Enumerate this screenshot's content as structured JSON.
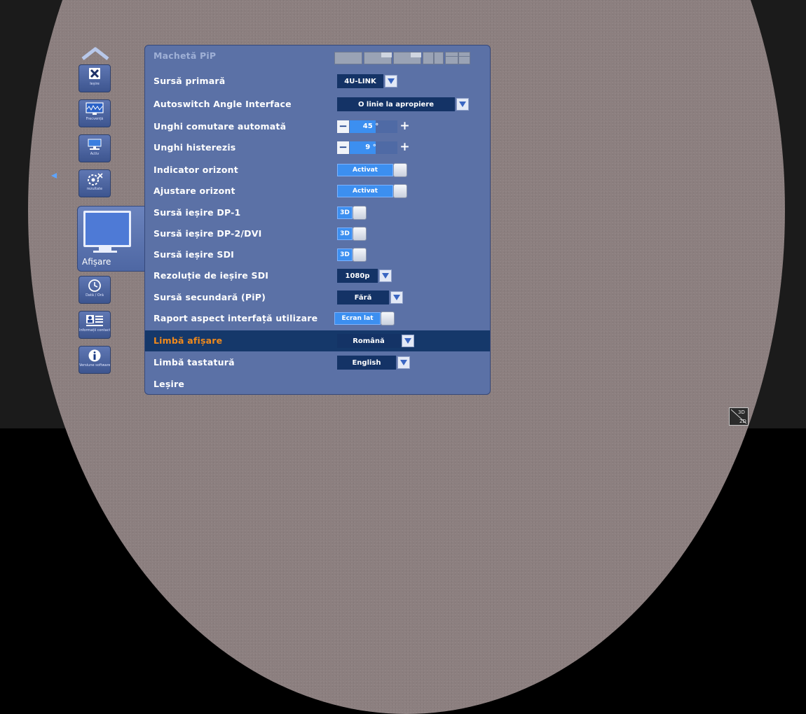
{
  "menu": {
    "rows": [
      {
        "key": "pip-layout",
        "label": "Machetă PiP",
        "control": "pip-layouts",
        "state": "disabled"
      },
      {
        "key": "primary-source",
        "label": "Sursă primară",
        "control": "dropdown",
        "value": "4U-LINK"
      },
      {
        "key": "autoswitch",
        "label": "Autoswitch Angle Interface",
        "control": "dropdown",
        "value": "O linie la apropiere"
      },
      {
        "key": "auto-switch-angle",
        "label": "Unghi comutare automată",
        "control": "stepper",
        "value": "45 °",
        "fill": 0.55
      },
      {
        "key": "hysteresis-angle",
        "label": "Unghi histerezis",
        "control": "stepper",
        "value": "9 °",
        "fill": 0.55
      },
      {
        "key": "horizon-indicator",
        "label": "Indicator orizont",
        "control": "toggle",
        "value": "Activat"
      },
      {
        "key": "horizon-adjust",
        "label": "Ajustare orizont",
        "control": "toggle",
        "value": "Activat"
      },
      {
        "key": "dp1-output",
        "label": "Sursă ieșire DP-1",
        "control": "toggle",
        "value": "3D"
      },
      {
        "key": "dp2-output",
        "label": "Sursă ieșire DP-2/DVI",
        "control": "toggle",
        "value": "3D"
      },
      {
        "key": "sdi-output",
        "label": "Sursă ieșire SDI",
        "control": "toggle",
        "value": "3D"
      },
      {
        "key": "sdi-resolution",
        "label": "Rezoluție de ieșire SDI",
        "control": "dropdown",
        "value": "1080p"
      },
      {
        "key": "secondary-source",
        "label": "Sursă secundară (PiP)",
        "control": "dropdown",
        "value": "Fără"
      },
      {
        "key": "ui-aspect",
        "label": "Raport aspect interfață utilizare",
        "control": "toggle",
        "value": "Ecran lat"
      },
      {
        "key": "display-language",
        "label": "Limbă afișare",
        "control": "dropdown",
        "value": "Română",
        "state": "selected"
      },
      {
        "key": "keyboard-language",
        "label": "Limbă tastatură",
        "control": "dropdown",
        "value": "English"
      },
      {
        "key": "exit",
        "label": "Leșire",
        "control": "none"
      }
    ]
  },
  "nav": {
    "items": [
      {
        "key": "exit",
        "label": "Ieșire",
        "icon": "close-x-icon"
      },
      {
        "key": "frequency",
        "label": "Frecvență",
        "icon": "frequency-icon"
      },
      {
        "key": "active",
        "label": "Activ",
        "icon": "network-icon"
      },
      {
        "key": "results",
        "label": "rezultate",
        "icon": "settings-network-icon"
      },
      {
        "key": "display",
        "label": "Afișare",
        "icon": "monitor-icon",
        "state": "selected"
      },
      {
        "key": "datetime",
        "label": "Dată / Oră",
        "icon": "clock-icon"
      },
      {
        "key": "contact",
        "label": "Informații contact",
        "icon": "contact-card-icon"
      },
      {
        "key": "software",
        "label": "Versiune software",
        "icon": "info-icon"
      }
    ]
  },
  "corner": {
    "top": "3D",
    "bottom": "2D"
  },
  "colors": {
    "panel": "#5b71a6",
    "selected_row": "#15386a",
    "selected_text": "#f08a1c",
    "accent": "#3c8ff0",
    "dropdown_bg": "#143366"
  }
}
